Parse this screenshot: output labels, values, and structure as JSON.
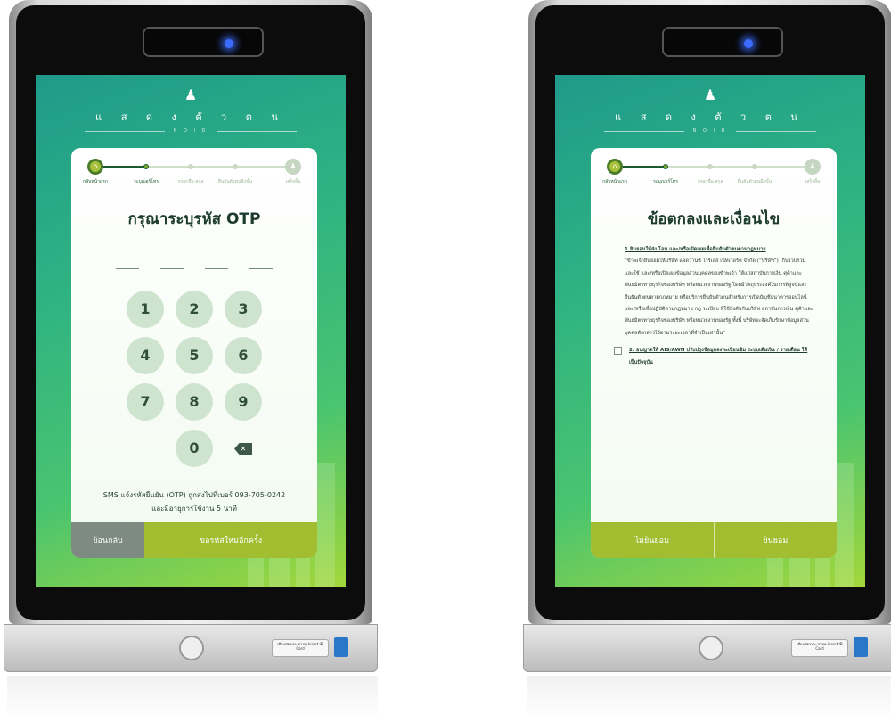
{
  "left_screen": {
    "header": {
      "title": "แ ส ด ง ตั ว ต น",
      "subtitle": "N O I D"
    },
    "stepper": {
      "steps": [
        "กลับหน้าแรก",
        "ระบุเบอร์โทร",
        "กรอกชื่อ-สกุล",
        "ยืนยันตัวตนอีกขั้น",
        "เสร็จสิ้น"
      ]
    },
    "title": "กรุณาระบุรหัส OTP",
    "keypad": {
      "keys": [
        "1",
        "2",
        "3",
        "4",
        "5",
        "6",
        "7",
        "8",
        "9",
        "0"
      ],
      "backspace_glyph": "✕"
    },
    "sms_note_line1": "SMS แจ้งรหัสยืนยัน (OTP) ถูกส่งไปที่เบอร์ 093-705-0242",
    "sms_note_line2": "และมีอายุการใช้งาน 5 นาที",
    "back_button": "ย้อนกลับ",
    "resend_button": "ขอรหัสใหม่อีกครั้ง"
  },
  "right_screen": {
    "header": {
      "title": "แ ส ด ง ตั ว ต น",
      "subtitle": "N O I D"
    },
    "stepper": {
      "steps": [
        "กลับหน้าแรก",
        "ระบุเบอร์โทร",
        "กรอกชื่อ-สกุล",
        "ยืนยันตัวตนอีกขั้น",
        "เสร็จสิ้น"
      ]
    },
    "title": "ข้อตกลงและเงื่อนไข",
    "terms_heading": "1.ยินยอมให้ส่ง โอน และ/หรือเปิดเผยเพื่อยืนยันตัวตนตามกฎหมาย",
    "terms_body": "“ข้าพเจ้ายินยอมให้บริษัท แอดวานซ์ ไวร์เลส เน็ทเวอร์ค จำกัด (“บริษัท”) เก็บรวบรวม และใช้ และ/หรือเปิดเผยข้อมูลส่วนบุคคลของข้าพเจ้า ให้แก่สถาบันการเงิน คู่ค้าและพันธมิตรทางธุรกิจของบริษัท หรือหน่วยงานของรัฐ โดยมีวัตถุประสงค์ในการพิสูจน์และยืนยันตัวตนตามกฎหมาย หรือบริการยืนยันตัวตนสำหรับการเปิดบัญชีธนาคารออนไลน์ และ/หรือเพื่อปฏิบัติตามกฎหมาย กฎ ระเบียบ ที่ใช้บังคับกับบริษัท สถาบันการเงิน คู่ค้าและพันธมิตรทางธุรกิจของบริษัท หรือหน่วยงานของรัฐ ทั้งนี้ บริษัทจะจัดเก็บรักษาข้อมูลส่วนบุคคลดังกล่าวไว้ตามระยะเวลาที่จำเป็นเท่านั้น”",
    "consent_text": "2. อนุญาตให้ AIS/AWN ปรับปรุงข้อมูลลงทะเบียนซิม ระบบเติมเงิน / รายเดือน ให้เป็นปัจจุบัน",
    "decline_button": "ไม่ยินยอม",
    "accept_button": "ยินยอม"
  },
  "base": {
    "card_slot_label": "เสียบบัตรประชาชน\nInsert ID Card"
  },
  "colors": {
    "screen_gradient_start": "#1f9a8a",
    "screen_gradient_end": "#a3d73a",
    "primary_button": "#a2bd2f",
    "secondary_button": "#7e8b82",
    "led": "#3b6cff"
  },
  "icons": {
    "header": "user-add-icon",
    "step_first": "home-icon",
    "step_last": "user-check-icon",
    "backspace": "backspace-icon"
  }
}
